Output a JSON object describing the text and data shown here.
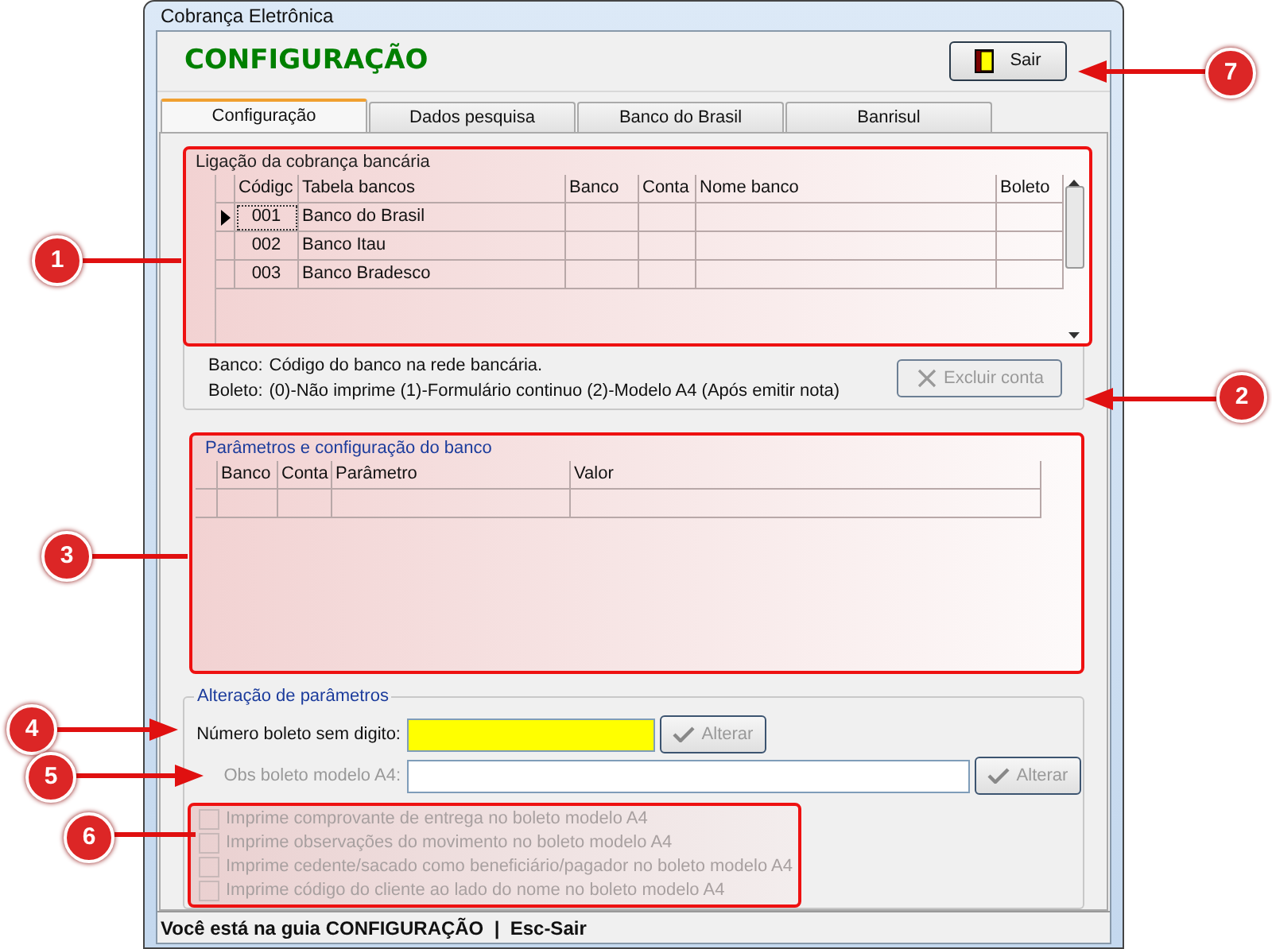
{
  "window": {
    "title": "Cobrança Eletrônica"
  },
  "header": {
    "title": "CONFIGURAÇÃO",
    "exit_button": "Sair"
  },
  "tabs": [
    {
      "label": "Configuração",
      "selected": true
    },
    {
      "label": "Dados pesquisa",
      "selected": false
    },
    {
      "label": "Banco do Brasil",
      "selected": false
    },
    {
      "label": "Banrisul",
      "selected": false
    }
  ],
  "bank_link": {
    "title": "Ligação da cobrança bancária",
    "columns": [
      "Códigc",
      "Tabela bancos",
      "Banco",
      "Conta",
      "Nome banco",
      "Boleto"
    ],
    "rows": [
      {
        "code": "001",
        "name": "Banco do Brasil",
        "selected": true
      },
      {
        "code": "002",
        "name": "Banco Itau",
        "selected": false
      },
      {
        "code": "003",
        "name": "Banco Bradesco",
        "selected": false
      }
    ],
    "notes": [
      {
        "label": "Banco:",
        "text": "Código do banco na rede bancária."
      },
      {
        "label": "Boleto:",
        "text": "(0)-Não imprime (1)-Formulário continuo (2)-Modelo A4 (Após emitir nota)"
      }
    ],
    "delete_button": {
      "label": "Excluir conta",
      "disabled": true
    }
  },
  "bank_params": {
    "title": "Parâmetros e configuração do banco",
    "columns": [
      "Banco",
      "Conta",
      "Parâmetro",
      "Valor"
    ]
  },
  "param_edit": {
    "title": "Alteração de parâmetros",
    "fields": [
      {
        "label": "Número boleto sem digito:",
        "disabled": false,
        "focused": true,
        "button": "Alterar"
      },
      {
        "label": "Obs boleto modelo A4:",
        "disabled": true,
        "focused": false,
        "button": "Alterar"
      }
    ],
    "options": [
      {
        "label": "Imprime comprovante de entrega no boleto modelo A4",
        "checked": false,
        "disabled": true
      },
      {
        "label": "Imprime observações do movimento no boleto modelo A4",
        "checked": false,
        "disabled": true
      },
      {
        "label": "Imprime cedente/sacado como beneficiário/pagador no boleto modelo A4",
        "checked": false,
        "disabled": true
      },
      {
        "label": "Imprime código do cliente ao lado do nome no boleto modelo A4",
        "checked": false,
        "disabled": true
      }
    ]
  },
  "status_bar": "Você está na guia CONFIGURAÇÃO  |  Esc-Sair",
  "callouts": [
    "1",
    "2",
    "3",
    "4",
    "5",
    "6",
    "7"
  ]
}
